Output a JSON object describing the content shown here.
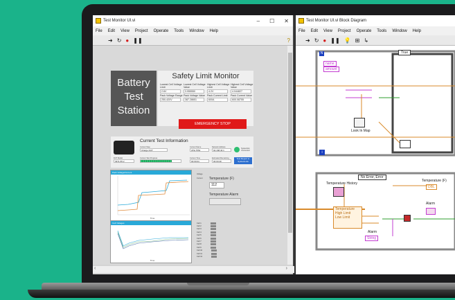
{
  "front_panel": {
    "title": "Test Monitor UI.vi",
    "menu": [
      "File",
      "Edit",
      "View",
      "Project",
      "Operate",
      "Tools",
      "Window",
      "Help"
    ],
    "battery_title": [
      "Battery",
      "Test",
      "Station"
    ],
    "safety": {
      "title": "Safety Limit Monitor",
      "labels": [
        "Lowest Cell Voltage Limit",
        "Lowest Cell Voltage Value",
        "Highest Cell Voltage Limit",
        "Highest Cell Voltage Value",
        "Pack Voltage Range",
        "Pack Voltage Value",
        "Pack Current Limit",
        "Pack Current Value"
      ],
      "values": [
        "2.6V",
        "3.955550",
        "4.2V",
        "4.044827",
        "250-420V",
        "387.28651",
        "600A",
        "600.08755"
      ],
      "estop_label": "EMERGENCY STOP"
    },
    "test_info": {
      "title": "Current Test Information",
      "fields": [
        {
          "label": "Current Step",
          "value": "Charge DUT"
        },
        {
          "label": "Current Name",
          "value": "ATE-7552"
        },
        {
          "label": "Network Address",
          "value": "92.168.40.1"
        },
        {
          "label": "DUT Model",
          "value": "3971-55.2"
        },
        {
          "label": "Current Test Progress",
          "value": ""
        },
        {
          "label": "Current Time",
          "value": "00:00:04"
        },
        {
          "label": "Estimated Remaining",
          "value": "00:00:49"
        }
      ],
      "connection_status": "Systemlink Connected",
      "report_button": "Test Report to SystemLink",
      "progress": 0.78
    },
    "voltage_chart": {
      "header": "Pack Voltage/Current",
      "x_label": "Time"
    },
    "cell_chart": {
      "header": "Cell Voltages",
      "x_label": "Time"
    },
    "temperature": {
      "label": "Temperature (F)",
      "value": "112"
    },
    "temperature_alarm": {
      "label": "Temperature Alarm"
    },
    "legend_items": [
      "Voltage",
      "Current"
    ],
    "cell_legend": [
      "Cell 1",
      "Cell 2",
      "Cell 3",
      "Cell 4",
      "Cell 5",
      "Cell 6",
      "Cell 7",
      "Cell 8",
      "Cell 9",
      "Cell 10",
      "Cell 11",
      "Cell 12"
    ]
  },
  "block_diagram": {
    "title": "Test Monitor UI.vi Block Diagram",
    "menu": [
      "File",
      "Edit",
      "View",
      "Project",
      "Operate",
      "Tools",
      "Window",
      "Help"
    ],
    "case_true": "True",
    "case_error": "No Error, Error",
    "look_in_map": "Look In Map",
    "name_label": "name",
    "amount_label": "amount",
    "temperature_history": "Temperature History",
    "temperature_f": "Temperature (F)",
    "temperature_f_value": "DBL",
    "alarm": "Alarm",
    "cluster_items": [
      "Temperature",
      "High Limit",
      "Low Limit"
    ],
    "alarm_string": "String",
    "alarm2": "Alarm"
  },
  "colors": {
    "background": "#1ab38a",
    "estop": "#e01919",
    "chart_header": "#29a9d8"
  }
}
